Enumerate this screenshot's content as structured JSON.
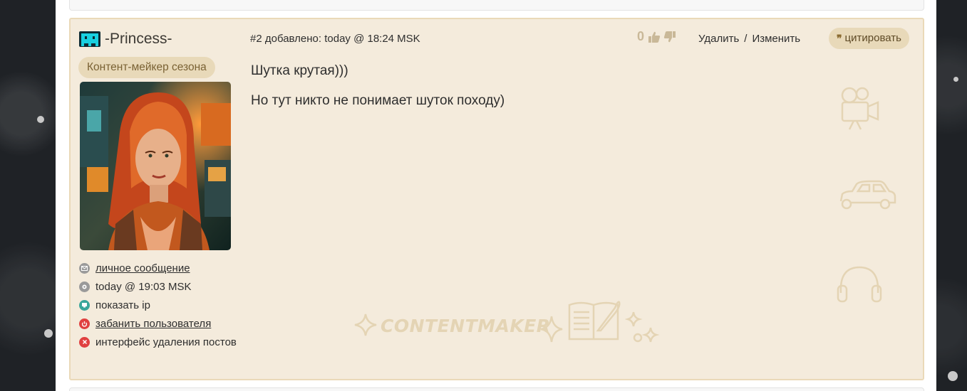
{
  "user": {
    "name": "-Princess-",
    "rank": "Контент-мейкер сезона",
    "links": {
      "pm": "личное сообщение",
      "last_seen": "today @ 19:03 MSK",
      "show_ip": "показать ip",
      "ban": "забанить пользователя",
      "delete_ui": "интерфейс удаления постов"
    }
  },
  "post": {
    "meta": "#2 добавлено: today @ 18:24 MSK",
    "rating": "0",
    "delete_label": "Удалить",
    "separator": "/",
    "edit_label": "Изменить",
    "quote_label": "цитировать",
    "quote_mark": "❞",
    "lines": [
      "Шутка крутая)))",
      "Но тут никто не понимает шуток походу)"
    ]
  },
  "watermark": {
    "text": "CONTENTMAKER"
  },
  "colors": {
    "post_bg": "#f4ebdc",
    "post_border": "#ead9b8",
    "badge_bg": "#e8d9b9",
    "badge_text": "#7a6234",
    "deco": "#e4d4b4"
  },
  "icons": [
    "user-rank-icon",
    "envelope-icon",
    "clock-icon",
    "monitor-icon",
    "power-icon",
    "close-icon",
    "thumbs-up-icon",
    "thumbs-down-icon",
    "quote-icon",
    "film-camera-icon",
    "car-icon",
    "headphones-icon",
    "sparkle-icon",
    "open-book-icon"
  ]
}
